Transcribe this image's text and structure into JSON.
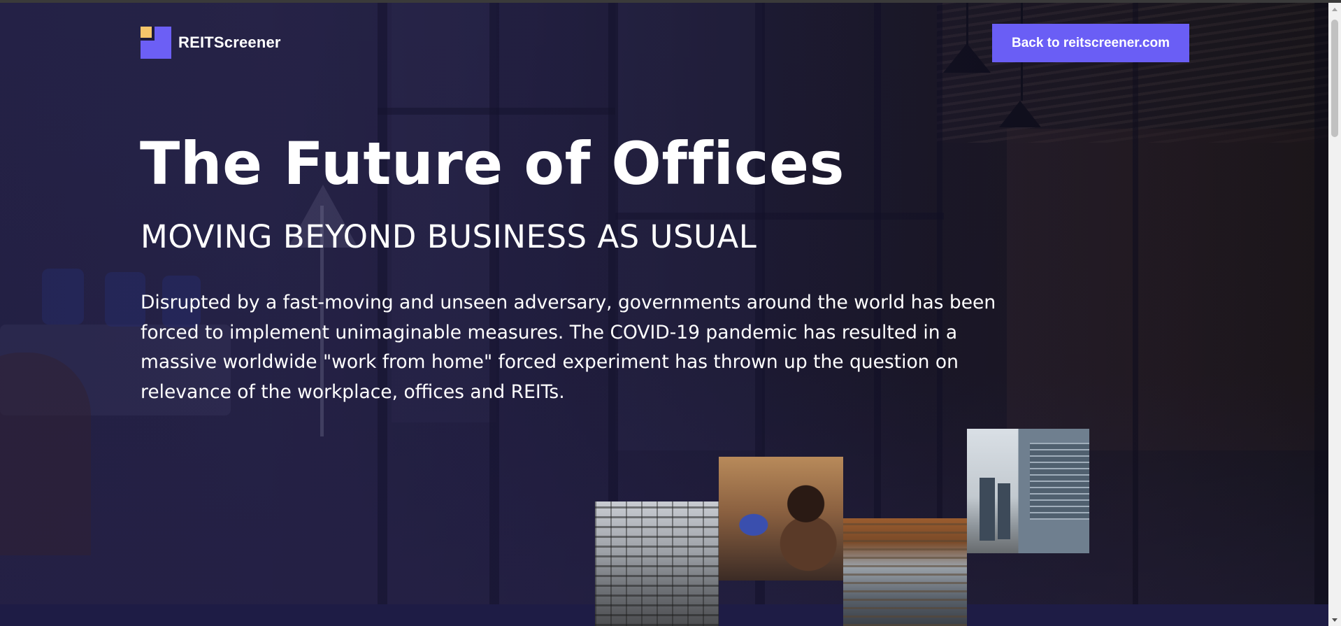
{
  "header": {
    "brand_name": "REITScreener",
    "back_button_label": "Back to reitscreener.com"
  },
  "hero": {
    "title": "The Future of Offices",
    "subtitle": "MOVING BEYOND BUSINESS AS USUAL",
    "intro": "Disrupted by a fast-moving and unseen adversary, governments around the world has been forced to implement unimaginable measures. The COVID-19 pandemic has resulted in a massive worldwide \"work from home\" forced experiment has thrown up the question on relevance of the workplace, offices and REITs."
  },
  "colors": {
    "accent": "#6a5ef5",
    "logo_yellow": "#f6c66a",
    "band": "#1e1c45"
  },
  "icons": {
    "logo": "reitscreener-logo-icon"
  }
}
